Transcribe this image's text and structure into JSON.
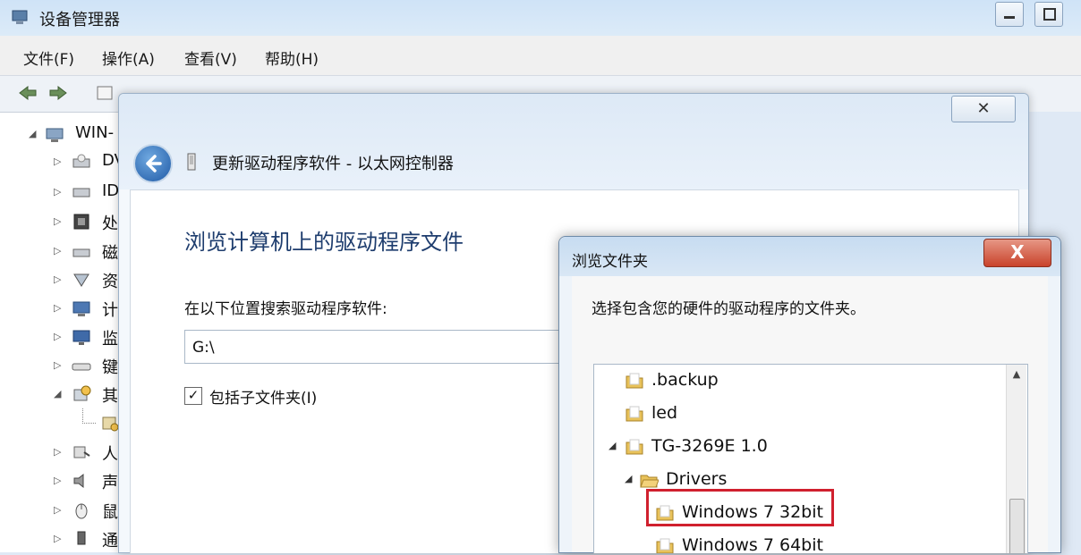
{
  "device_manager": {
    "title": "设备管理器",
    "menu": [
      "文件(F)",
      "操作(A)",
      "查看(V)",
      "帮助(H)"
    ],
    "tree": {
      "root": "WIN-",
      "nodes": [
        {
          "label": "DV",
          "icon": "dvd-drive-icon"
        },
        {
          "label": "ID",
          "icon": "ide-controller-icon"
        },
        {
          "label": "处",
          "icon": "processor-icon"
        },
        {
          "label": "磁",
          "icon": "disk-drive-icon"
        },
        {
          "label": "资",
          "icon": "resource-icon"
        },
        {
          "label": "计",
          "icon": "computer-icon"
        },
        {
          "label": "监",
          "icon": "monitor-icon"
        },
        {
          "label": "键",
          "icon": "keyboard-icon"
        },
        {
          "label": "其",
          "icon": "other-devices-icon"
        },
        {
          "label": "",
          "icon": "unknown-device-icon"
        },
        {
          "label": "人",
          "icon": "hid-icon"
        },
        {
          "label": "声",
          "icon": "sound-icon"
        },
        {
          "label": "鼠",
          "icon": "mouse-icon"
        },
        {
          "label": "通",
          "icon": "usb-controller-icon"
        }
      ]
    }
  },
  "update_dialog": {
    "title": "更新驱动程序软件 - 以太网控制器",
    "close": "✕",
    "heading": "浏览计算机上的驱动程序文件",
    "search_label": "在以下位置搜索驱动程序软件:",
    "path_value": "G:\\",
    "include_subfolders_label": "包括子文件夹(I)",
    "include_subfolders_checked": true
  },
  "browse_dialog": {
    "title": "浏览文件夹",
    "close": "X",
    "description": "选择包含您的硬件的驱动程序的文件夹。",
    "folders": [
      {
        "label": ".backup",
        "expanded": false,
        "level": 0
      },
      {
        "label": "led",
        "expanded": false,
        "level": 0
      },
      {
        "label": "TG-3269E 1.0",
        "expanded": true,
        "level": 0
      },
      {
        "label": "Drivers",
        "expanded": true,
        "level": 1
      },
      {
        "label": "Windows 7 32bit",
        "expanded": false,
        "level": 2,
        "selected": true
      },
      {
        "label": "Windows 7 64bit",
        "expanded": false,
        "level": 2
      }
    ]
  },
  "colors": {
    "highlight_border": "#d0202e",
    "close_button_red": "#c9432b",
    "heading_blue": "#1e3d6e"
  }
}
